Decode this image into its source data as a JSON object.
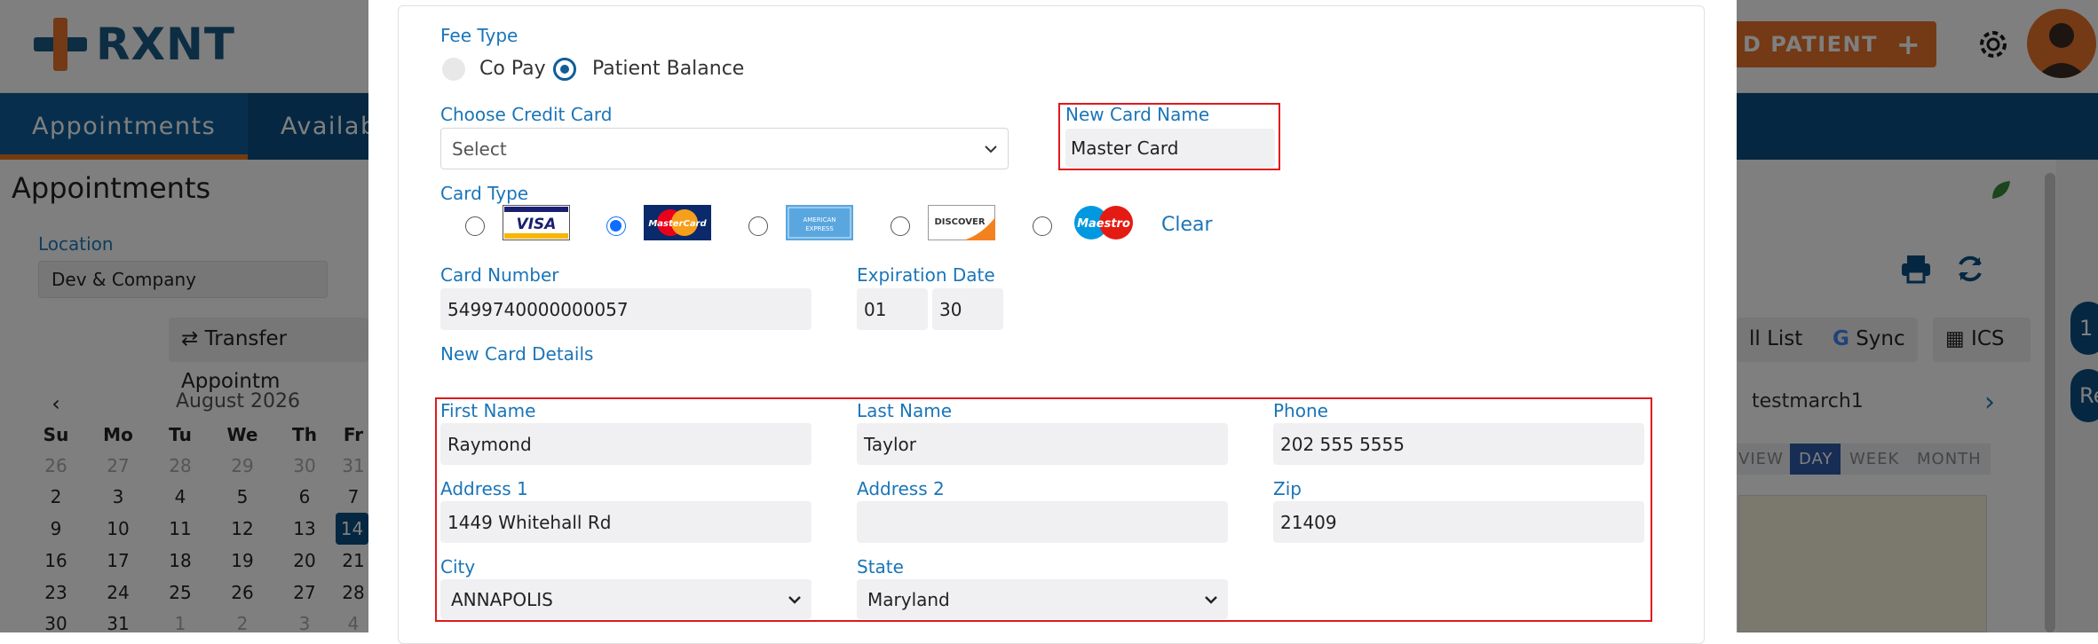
{
  "app": {
    "logo_text": "RXNT",
    "add_patient_label": "D PATIENT",
    "plus_label": "+",
    "nav": [
      "Appointments",
      "Availab"
    ],
    "page_title": "Appointments",
    "location_label": "Location",
    "location_value": "Dev & Company",
    "transfer_label": "Transfer Appointm",
    "call_list_label": "ll List",
    "sync_label": "Sync",
    "ics_label": "ICS",
    "provider_name": "testmarch1",
    "view_buttons": [
      "VIEW",
      "DAY",
      "WEEK",
      "MONTH"
    ],
    "right_btns": [
      "1",
      "Re"
    ],
    "calendar": {
      "month_label": "August 2026",
      "weekdays": [
        "Su",
        "Mo",
        "Tu",
        "We",
        "Th",
        "Fr"
      ],
      "rows": [
        [
          "26",
          "27",
          "28",
          "29",
          "30",
          "31"
        ],
        [
          "2",
          "3",
          "4",
          "5",
          "6",
          "7"
        ],
        [
          "9",
          "10",
          "11",
          "12",
          "13",
          "14"
        ],
        [
          "16",
          "17",
          "18",
          "19",
          "20",
          "21"
        ],
        [
          "23",
          "24",
          "25",
          "26",
          "27",
          "28"
        ],
        [
          "30",
          "31",
          "1",
          "2",
          "3",
          "4"
        ]
      ]
    }
  },
  "form": {
    "fee_type_label": "Fee Type",
    "fee_options": [
      "Co Pay",
      "Patient Balance"
    ],
    "fee_selected": "Patient Balance",
    "choose_card_label": "Choose Credit Card",
    "choose_card_placeholder": "Select",
    "new_card_name_label": "New Card Name",
    "new_card_name_value": "Master Card",
    "card_type_label": "Card Type",
    "card_types": [
      "VISA",
      "MasterCard",
      "AMERICAN EXPRESS",
      "DISCOVER",
      "Maestro"
    ],
    "card_type_selected": "MasterCard",
    "clear_label": "Clear",
    "card_number_label": "Card Number",
    "card_number_value": "5499740000000057",
    "expiration_label": "Expiration Date",
    "exp_month": "01",
    "exp_year": "30",
    "new_card_details_label": "New Card Details",
    "first_name_label": "First Name",
    "first_name_value": "Raymond",
    "last_name_label": "Last Name",
    "last_name_value": "Taylor",
    "phone_label": "Phone",
    "phone_value": "202 555 5555",
    "address1_label": "Address 1",
    "address1_value": "1449 Whitehall Rd",
    "address2_label": "Address 2",
    "address2_value": "",
    "zip_label": "Zip",
    "zip_value": "21409",
    "city_label": "City",
    "city_value": "ANNAPOLIS",
    "state_label": "State",
    "state_value": "Maryland"
  },
  "colors": {
    "brand_navy": "#0b4f83",
    "accent_orange": "#e8732b",
    "label_blue": "#1a75b8",
    "highlight_red": "#e0191e"
  }
}
